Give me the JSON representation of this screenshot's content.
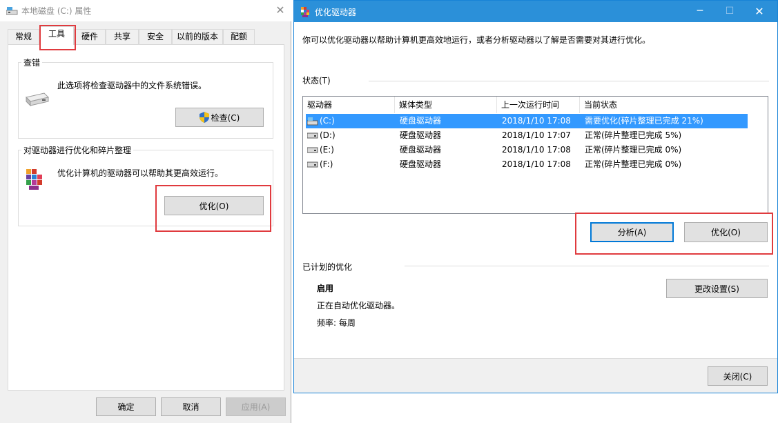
{
  "left_window": {
    "title": "本地磁盘 (C:) 属性",
    "tabs": [
      "常规",
      "工具",
      "硬件",
      "共享",
      "安全",
      "以前的版本",
      "配额"
    ],
    "check_group": {
      "label": "查错",
      "description": "此选项将检查驱动器中的文件系统错误。",
      "button": "检查(C)"
    },
    "optimize_group": {
      "label": "对驱动器进行优化和碎片整理",
      "description": "优化计算机的驱动器可以帮助其更高效运行。",
      "button": "优化(O)"
    },
    "footer": {
      "ok": "确定",
      "cancel": "取消",
      "apply": "应用(A)"
    }
  },
  "right_window": {
    "title": "优化驱动器",
    "intro": "你可以优化驱动器以帮助计算机更高效地运行，或者分析驱动器以了解是否需要对其进行优化。",
    "status_label": "状态(T)",
    "columns": [
      "驱动器",
      "媒体类型",
      "上一次运行时间",
      "当前状态"
    ],
    "drives": [
      {
        "drive": "(C:)",
        "media": "硬盘驱动器",
        "last_run": "2018/1/10 17:08",
        "status": "需要优化(碎片整理已完成 21%)"
      },
      {
        "drive": "(D:)",
        "media": "硬盘驱动器",
        "last_run": "2018/1/10 17:07",
        "status": "正常(碎片整理已完成 5%)"
      },
      {
        "drive": "(E:)",
        "media": "硬盘驱动器",
        "last_run": "2018/1/10 17:08",
        "status": "正常(碎片整理已完成 0%)"
      },
      {
        "drive": "(F:)",
        "media": "硬盘驱动器",
        "last_run": "2018/1/10 17:08",
        "status": "正常(碎片整理已完成 0%)"
      }
    ],
    "analyze_button": "分析(A)",
    "optimize_button": "优化(O)",
    "scheduled": {
      "label": "已计划的优化",
      "state": "启用",
      "description": "正在自动优化驱动器。",
      "frequency": "频率: 每周",
      "change_button": "更改设置(S)"
    },
    "close_button": "关闭(C)"
  },
  "colors": {
    "accent": "#2b90d9",
    "selection": "#3399ff",
    "highlight": "#e03a3e"
  }
}
